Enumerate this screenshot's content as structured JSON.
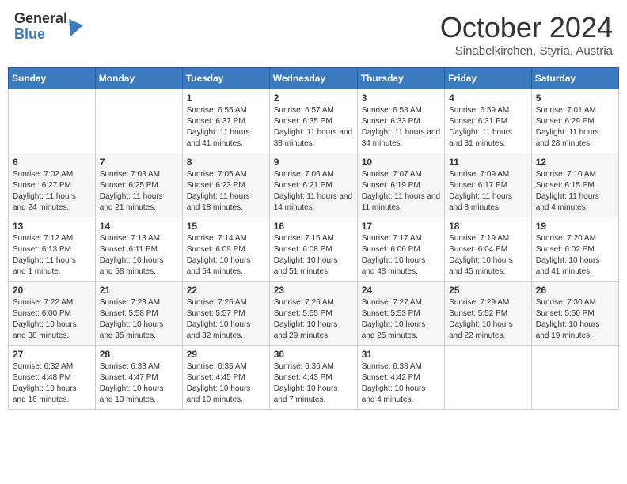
{
  "header": {
    "logo_general": "General",
    "logo_blue": "Blue",
    "month_title": "October 2024",
    "subtitle": "Sinabelkirchen, Styria, Austria"
  },
  "weekdays": [
    "Sunday",
    "Monday",
    "Tuesday",
    "Wednesday",
    "Thursday",
    "Friday",
    "Saturday"
  ],
  "weeks": [
    [
      {
        "day": "",
        "info": ""
      },
      {
        "day": "",
        "info": ""
      },
      {
        "day": "1",
        "info": "Sunrise: 6:55 AM\nSunset: 6:37 PM\nDaylight: 11 hours and 41 minutes."
      },
      {
        "day": "2",
        "info": "Sunrise: 6:57 AM\nSunset: 6:35 PM\nDaylight: 11 hours and 38 minutes."
      },
      {
        "day": "3",
        "info": "Sunrise: 6:58 AM\nSunset: 6:33 PM\nDaylight: 11 hours and 34 minutes."
      },
      {
        "day": "4",
        "info": "Sunrise: 6:59 AM\nSunset: 6:31 PM\nDaylight: 11 hours and 31 minutes."
      },
      {
        "day": "5",
        "info": "Sunrise: 7:01 AM\nSunset: 6:29 PM\nDaylight: 11 hours and 28 minutes."
      }
    ],
    [
      {
        "day": "6",
        "info": "Sunrise: 7:02 AM\nSunset: 6:27 PM\nDaylight: 11 hours and 24 minutes."
      },
      {
        "day": "7",
        "info": "Sunrise: 7:03 AM\nSunset: 6:25 PM\nDaylight: 11 hours and 21 minutes."
      },
      {
        "day": "8",
        "info": "Sunrise: 7:05 AM\nSunset: 6:23 PM\nDaylight: 11 hours and 18 minutes."
      },
      {
        "day": "9",
        "info": "Sunrise: 7:06 AM\nSunset: 6:21 PM\nDaylight: 11 hours and 14 minutes."
      },
      {
        "day": "10",
        "info": "Sunrise: 7:07 AM\nSunset: 6:19 PM\nDaylight: 11 hours and 11 minutes."
      },
      {
        "day": "11",
        "info": "Sunrise: 7:09 AM\nSunset: 6:17 PM\nDaylight: 11 hours and 8 minutes."
      },
      {
        "day": "12",
        "info": "Sunrise: 7:10 AM\nSunset: 6:15 PM\nDaylight: 11 hours and 4 minutes."
      }
    ],
    [
      {
        "day": "13",
        "info": "Sunrise: 7:12 AM\nSunset: 6:13 PM\nDaylight: 11 hours and 1 minute."
      },
      {
        "day": "14",
        "info": "Sunrise: 7:13 AM\nSunset: 6:11 PM\nDaylight: 10 hours and 58 minutes."
      },
      {
        "day": "15",
        "info": "Sunrise: 7:14 AM\nSunset: 6:09 PM\nDaylight: 10 hours and 54 minutes."
      },
      {
        "day": "16",
        "info": "Sunrise: 7:16 AM\nSunset: 6:08 PM\nDaylight: 10 hours and 51 minutes."
      },
      {
        "day": "17",
        "info": "Sunrise: 7:17 AM\nSunset: 6:06 PM\nDaylight: 10 hours and 48 minutes."
      },
      {
        "day": "18",
        "info": "Sunrise: 7:19 AM\nSunset: 6:04 PM\nDaylight: 10 hours and 45 minutes."
      },
      {
        "day": "19",
        "info": "Sunrise: 7:20 AM\nSunset: 6:02 PM\nDaylight: 10 hours and 41 minutes."
      }
    ],
    [
      {
        "day": "20",
        "info": "Sunrise: 7:22 AM\nSunset: 6:00 PM\nDaylight: 10 hours and 38 minutes."
      },
      {
        "day": "21",
        "info": "Sunrise: 7:23 AM\nSunset: 5:58 PM\nDaylight: 10 hours and 35 minutes."
      },
      {
        "day": "22",
        "info": "Sunrise: 7:25 AM\nSunset: 5:57 PM\nDaylight: 10 hours and 32 minutes."
      },
      {
        "day": "23",
        "info": "Sunrise: 7:26 AM\nSunset: 5:55 PM\nDaylight: 10 hours and 29 minutes."
      },
      {
        "day": "24",
        "info": "Sunrise: 7:27 AM\nSunset: 5:53 PM\nDaylight: 10 hours and 25 minutes."
      },
      {
        "day": "25",
        "info": "Sunrise: 7:29 AM\nSunset: 5:52 PM\nDaylight: 10 hours and 22 minutes."
      },
      {
        "day": "26",
        "info": "Sunrise: 7:30 AM\nSunset: 5:50 PM\nDaylight: 10 hours and 19 minutes."
      }
    ],
    [
      {
        "day": "27",
        "info": "Sunrise: 6:32 AM\nSunset: 4:48 PM\nDaylight: 10 hours and 16 minutes."
      },
      {
        "day": "28",
        "info": "Sunrise: 6:33 AM\nSunset: 4:47 PM\nDaylight: 10 hours and 13 minutes."
      },
      {
        "day": "29",
        "info": "Sunrise: 6:35 AM\nSunset: 4:45 PM\nDaylight: 10 hours and 10 minutes."
      },
      {
        "day": "30",
        "info": "Sunrise: 6:36 AM\nSunset: 4:43 PM\nDaylight: 10 hours and 7 minutes."
      },
      {
        "day": "31",
        "info": "Sunrise: 6:38 AM\nSunset: 4:42 PM\nDaylight: 10 hours and 4 minutes."
      },
      {
        "day": "",
        "info": ""
      },
      {
        "day": "",
        "info": ""
      }
    ]
  ]
}
